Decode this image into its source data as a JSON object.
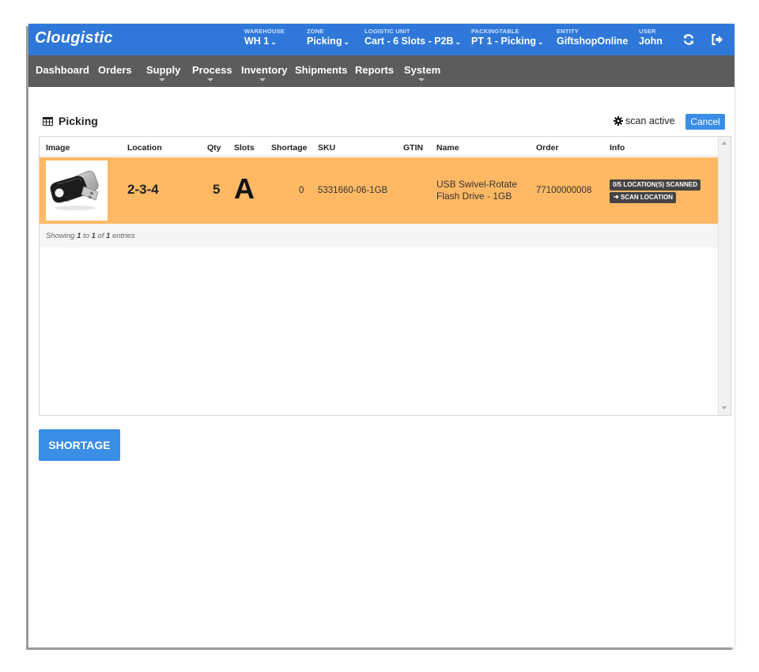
{
  "app": {
    "logo": "Clougistic"
  },
  "header": {
    "fields": [
      {
        "caption": "Warehouse",
        "value": "WH 1",
        "dropdown": true
      },
      {
        "caption": "Zone",
        "value": "Picking",
        "dropdown": true
      },
      {
        "caption": "Logistic unit",
        "value": "Cart - 6 Slots - P2B",
        "dropdown": true
      },
      {
        "caption": "Packingtable",
        "value": "PT 1 - Picking",
        "dropdown": true
      },
      {
        "caption": "Entity",
        "value": "GiftshopOnline",
        "dropdown": false
      },
      {
        "caption": "User",
        "value": "John",
        "dropdown": false
      }
    ],
    "icons": [
      "refresh-icon",
      "logout-icon"
    ],
    "colors": {
      "bar": "#2f78d9",
      "nav": "#5c5c5c"
    }
  },
  "nav": {
    "items": [
      {
        "label": "Dashboard",
        "submenu": false
      },
      {
        "label": "Orders",
        "submenu": false
      },
      {
        "label": "Supply",
        "submenu": true
      },
      {
        "label": "Process",
        "submenu": true
      },
      {
        "label": "Inventory",
        "submenu": true
      },
      {
        "label": "Shipments",
        "submenu": false
      },
      {
        "label": "Reports",
        "submenu": false
      },
      {
        "label": "System",
        "submenu": true
      }
    ]
  },
  "page": {
    "title": "Picking",
    "scan_status": "scan active",
    "cancel_label": "Cancel",
    "shortage_label": "SHORTAGE"
  },
  "table": {
    "columns": [
      "Image",
      "Location",
      "Qty",
      "Slots",
      "Shortage",
      "SKU",
      "GTIN",
      "Name",
      "Order",
      "Info"
    ],
    "rows": [
      {
        "image": "usb-flash-drive-image",
        "location": "2-3-4",
        "qty": "5",
        "slot": "A",
        "shortage": "0",
        "sku": "5331660-06-1GB",
        "gtin": "",
        "name_line1": "USB Swivel-Rotate",
        "name_line2": "Flash Drive - 1GB",
        "order": "77100000008",
        "badge_scanned": "0/5 LOCATION(S) SCANNED",
        "badge_scan": "SCAN LOCATION",
        "row_color": "#ffb964"
      }
    ],
    "footer": {
      "prefix": "Showing",
      "from": "1",
      "to_word": "to",
      "to": "1",
      "of_word": "of",
      "total": "1",
      "suffix": "entries"
    }
  }
}
